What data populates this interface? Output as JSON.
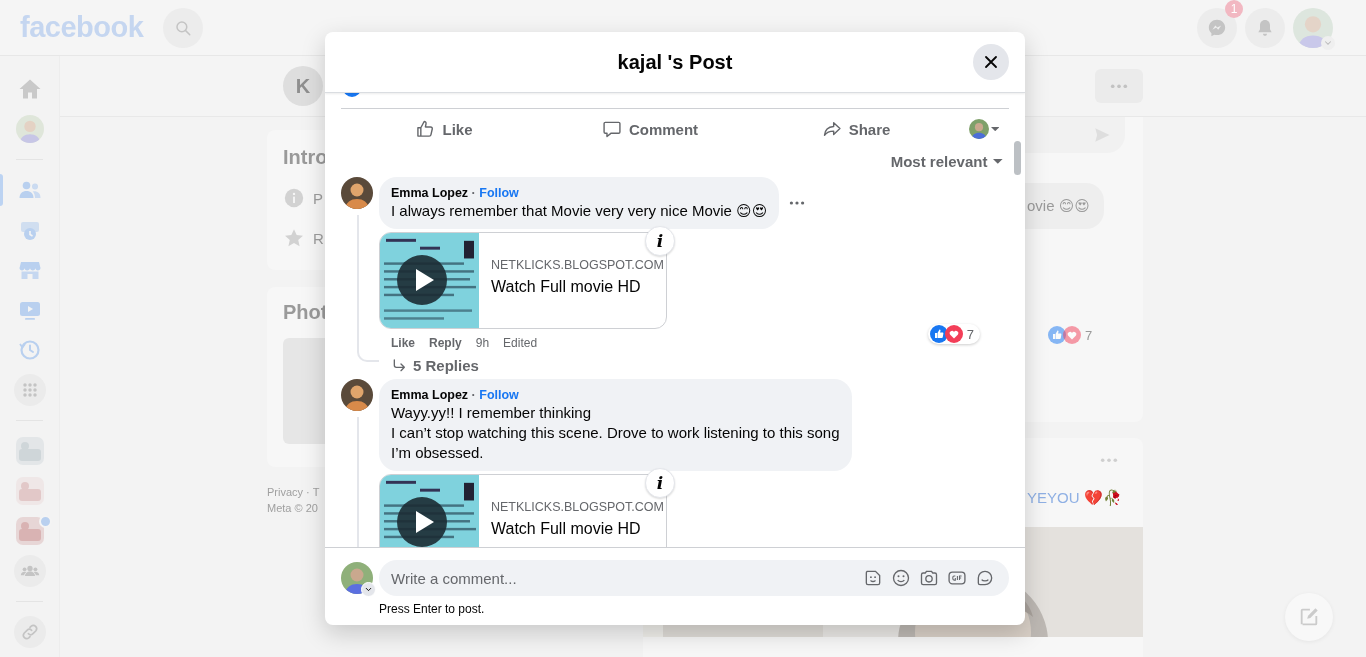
{
  "topbar": {
    "logo": "facebook",
    "messenger_badge": "1"
  },
  "sidebar": {
    "sections": [
      {
        "items": [
          {
            "kind": "home",
            "selected": false,
            "unread": false
          },
          {
            "kind": "profile",
            "selected": false,
            "unread": false
          }
        ]
      },
      {
        "items": [
          {
            "kind": "friends",
            "selected": true,
            "unread": false
          },
          {
            "kind": "feeds",
            "selected": false,
            "unread": false
          },
          {
            "kind": "marketplace",
            "selected": false,
            "unread": false
          },
          {
            "kind": "watch",
            "selected": false,
            "unread": false
          },
          {
            "kind": "memories",
            "selected": false,
            "unread": false
          },
          {
            "kind": "apps",
            "selected": false,
            "unread": false
          }
        ]
      },
      {
        "items": [
          {
            "kind": "shortcut",
            "selected": false,
            "unread": false
          },
          {
            "kind": "shortcut",
            "selected": false,
            "unread": false
          },
          {
            "kind": "shortcut",
            "selected": false,
            "unread": true
          },
          {
            "kind": "groups",
            "selected": false,
            "unread": false
          }
        ]
      },
      {
        "items": [
          {
            "kind": "link",
            "selected": false,
            "unread": false
          }
        ]
      }
    ]
  },
  "background": {
    "profile_initial": "K",
    "intro": {
      "title": "Intro",
      "items": [
        {
          "kind": "info",
          "label": "P"
        },
        {
          "kind": "star",
          "label": "R"
        }
      ]
    },
    "photos": {
      "title": "Phot"
    },
    "footer": [
      "Privacy · T",
      "Meta © 20"
    ],
    "comment_text": "ovie 😊😍",
    "reaction_count": "7",
    "post_text": "YEYOU 💔🥀"
  },
  "modal": {
    "title": "kajal 's Post",
    "actions": [
      {
        "kind": "like",
        "label": "Like"
      },
      {
        "kind": "comment",
        "label": "Comment"
      },
      {
        "kind": "share",
        "label": "Share"
      }
    ],
    "sort": "Most relevant",
    "comments": [
      {
        "author": "Emma Lopez",
        "separator": "·",
        "follow": "Follow",
        "lines": [
          "I always remember that Movie very very nice Movie 😊😍"
        ],
        "link": {
          "domain": "NETKLICKS.BLOGSPOT.COM",
          "title": "Watch Full movie HD",
          "info": "i"
        },
        "like": "Like",
        "reply": "Reply",
        "time": "9h",
        "edited": "Edited",
        "reaction_count": "7",
        "replies": "5 Replies"
      },
      {
        "author": "Emma Lopez",
        "separator": "·",
        "follow": "Follow",
        "lines": [
          "Wayy.yy!! I remember thinking",
          "I can’t stop watching this scene. Drove to work listening to this song",
          "I’m obsessed."
        ],
        "link": {
          "domain": "NETKLICKS.BLOGSPOT.COM",
          "title": "Watch Full movie HD",
          "info": "i"
        }
      }
    ],
    "composer": {
      "placeholder": "Write a comment...",
      "hint": "Press Enter to post."
    }
  }
}
